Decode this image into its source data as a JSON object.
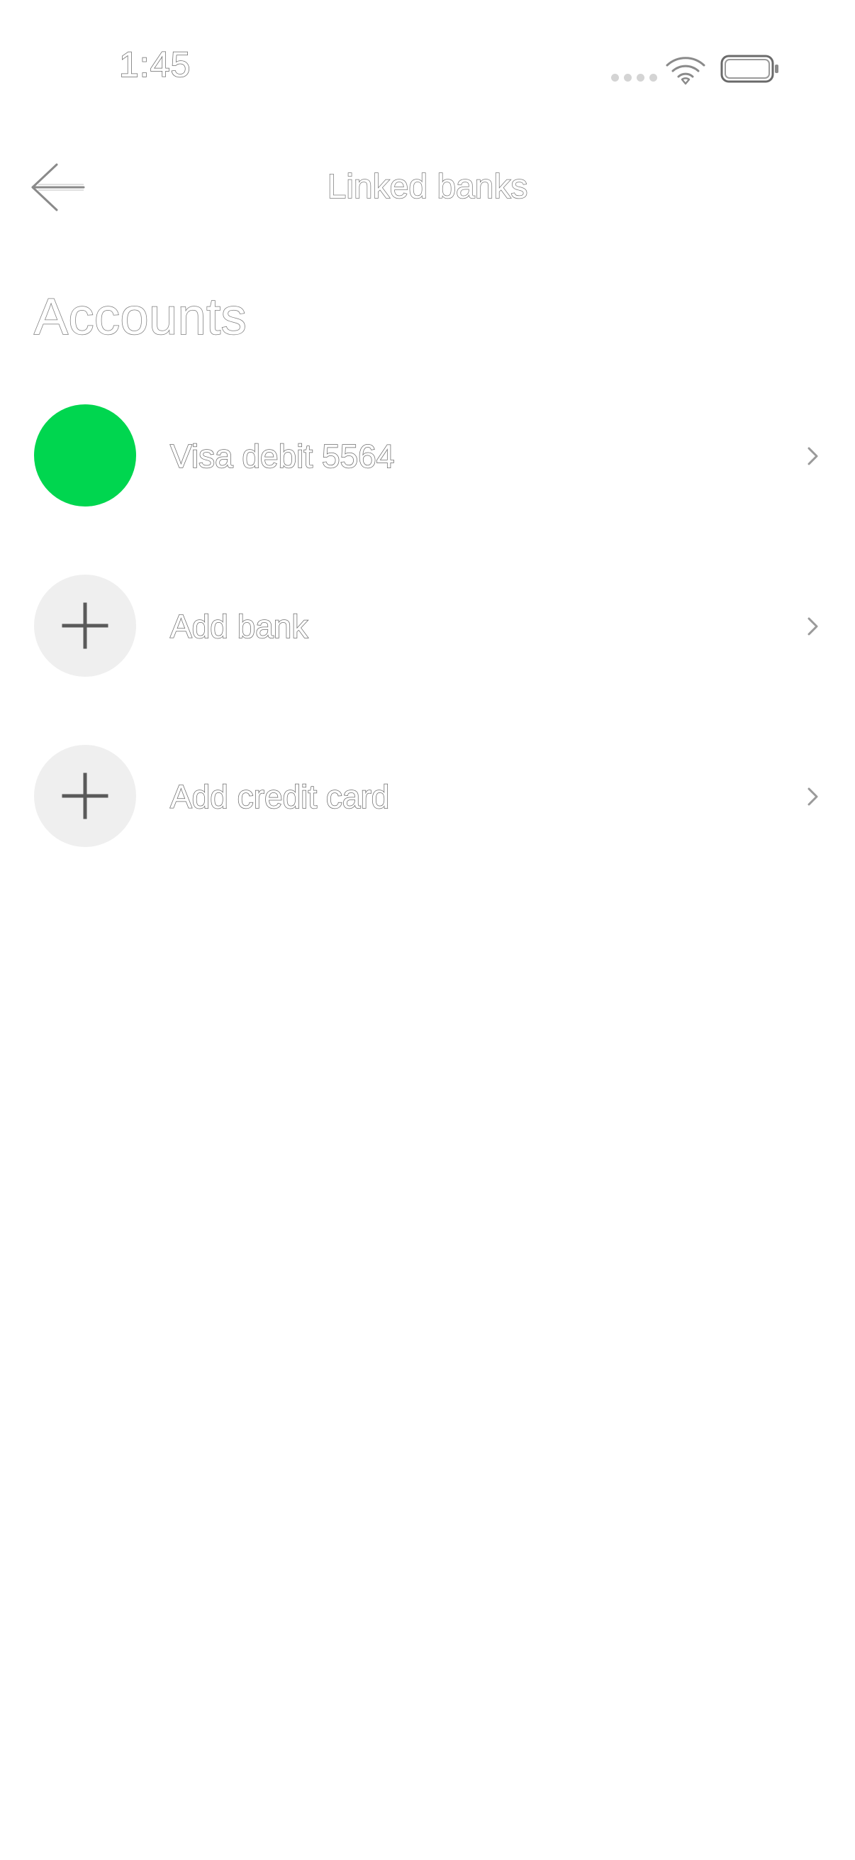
{
  "status_bar": {
    "time": "1:45",
    "signal_icon": "signal-dots-icon",
    "wifi_icon": "wifi-icon",
    "battery_icon": "battery-icon"
  },
  "nav": {
    "back_icon": "arrow-left-icon",
    "title": "Linked banks"
  },
  "section": {
    "title": "Accounts"
  },
  "accounts": [
    {
      "label": "Visa debit 5564",
      "avatar": "green-circle",
      "avatar_color": "#00d64f",
      "chevron_icon": "chevron-right-icon"
    },
    {
      "label": "Add bank",
      "avatar": "plus-icon",
      "avatar_color": "#efefef",
      "chevron_icon": "chevron-right-icon"
    },
    {
      "label": "Add credit card",
      "avatar": "plus-icon",
      "avatar_color": "#efefef",
      "chevron_icon": "chevron-right-icon"
    }
  ]
}
